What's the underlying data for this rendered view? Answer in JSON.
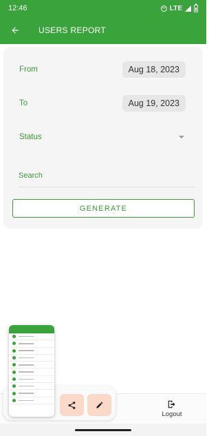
{
  "status_bar": {
    "time": "12:46",
    "network": "LTE",
    "icons": [
      "do-not-disturb-icon",
      "signal-icon",
      "battery-icon"
    ]
  },
  "app_bar": {
    "title": "USERS REPORT",
    "back_icon": "arrow-back-icon"
  },
  "form": {
    "from_label": "From",
    "from_value": "Aug 18, 2023",
    "to_label": "To",
    "to_value": "Aug 19, 2023",
    "status_label": "Status",
    "status_icon": "dropdown-arrow-icon",
    "search_placeholder": "Search",
    "generate_label": "GENERATE"
  },
  "bottom_nav": {
    "logout_label": "Logout",
    "logout_icon": "logout-icon"
  },
  "screenshot_preview": {
    "share_icon": "share-icon",
    "edit_icon": "edit-pencil-icon"
  },
  "colors": {
    "primary_green": "#3ba33b",
    "label_green": "#3a9a3a",
    "card_background": "#f5f5f5",
    "chip_background": "#e6e6e6",
    "action_button_background": "#fbd9c8"
  }
}
